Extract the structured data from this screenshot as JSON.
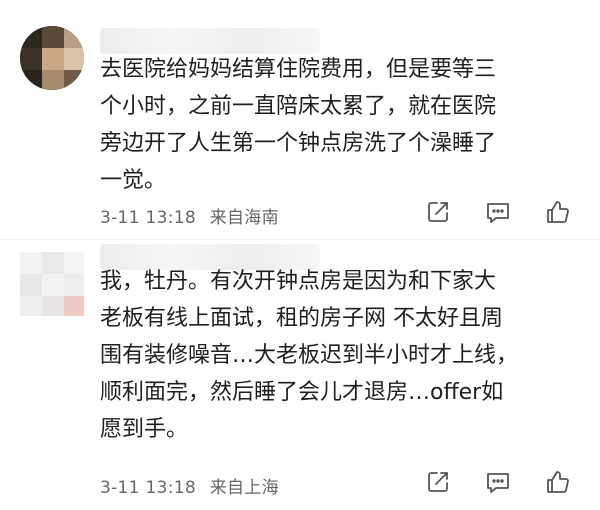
{
  "comments": [
    {
      "content": "去医院给妈妈结算住院费用，但是要等三\n个小时，之前一直陪床太累了，就在医院\n旁边开了人生第一个钟点房洗了个澡睡了\n一觉。",
      "time": "3-11 13:18",
      "location": "来自海南",
      "icons": {
        "share": "share-icon",
        "comment": "comment-icon",
        "like": "thumbs-up-icon"
      }
    },
    {
      "content": "我，牡丹。有次开钟点房是因为和下家大\n老板有线上面试，租的房子网 不太好且周\n围有装修噪音…大老板迟到半小时才上线，\n顺利面完，然后睡了会儿才退房…offer如\n愿到手。",
      "time": "3-11 13:18",
      "location": "来自上海",
      "icons": {
        "share": "share-icon",
        "comment": "comment-icon",
        "like": "thumbs-up-icon"
      }
    }
  ],
  "colors": {
    "text": "#1f1f1f",
    "meta": "#666666",
    "icon": "#555555"
  }
}
